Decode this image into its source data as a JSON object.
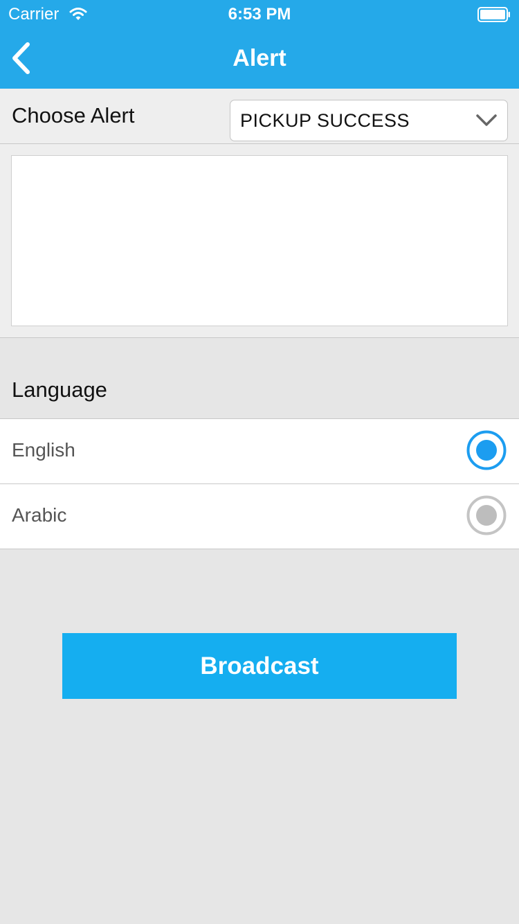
{
  "status_bar": {
    "carrier": "Carrier",
    "time": "6:53 PM"
  },
  "nav": {
    "title": "Alert",
    "back_icon": "chevron-left-icon"
  },
  "choose_alert": {
    "label": "Choose Alert",
    "selected_value": "PICKUP SUCCESS",
    "dropdown_icon": "chevron-down-icon"
  },
  "message": {
    "value": "",
    "placeholder": ""
  },
  "language": {
    "header": "Language",
    "options": [
      {
        "label": "English",
        "selected": true
      },
      {
        "label": "Arabic",
        "selected": false
      }
    ]
  },
  "actions": {
    "broadcast_label": "Broadcast"
  },
  "colors": {
    "primary": "#25a9e9",
    "button": "#15aef0",
    "radio_selected": "#1c9df0",
    "radio_unselected": "#bdbdbd",
    "background": "#e6e6e6"
  }
}
